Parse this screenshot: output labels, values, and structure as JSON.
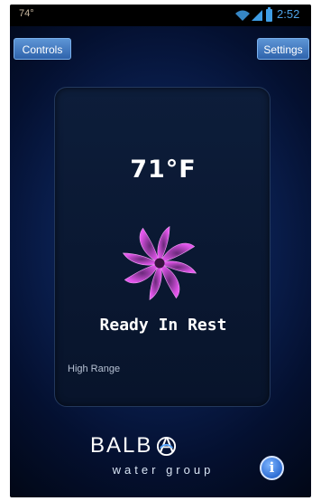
{
  "status_bar": {
    "left_text": "74°",
    "time": "2:52",
    "icons": [
      "wifi-icon",
      "signal-icon",
      "battery-icon"
    ]
  },
  "header": {
    "controls_label": "Controls",
    "settings_label": "Settings"
  },
  "main": {
    "temperature": "71°F",
    "status": "Ready In Rest",
    "range": "High Range",
    "status_icon": "pinwheel-icon"
  },
  "footer": {
    "logo_word": "BALB  A",
    "logo_sub": "water group",
    "info_icon": "info-icon",
    "info_glyph": "i"
  },
  "colors": {
    "accent": "#2f63ab",
    "pinwheel": "#d94fe0",
    "background": "#0a1f4f"
  }
}
